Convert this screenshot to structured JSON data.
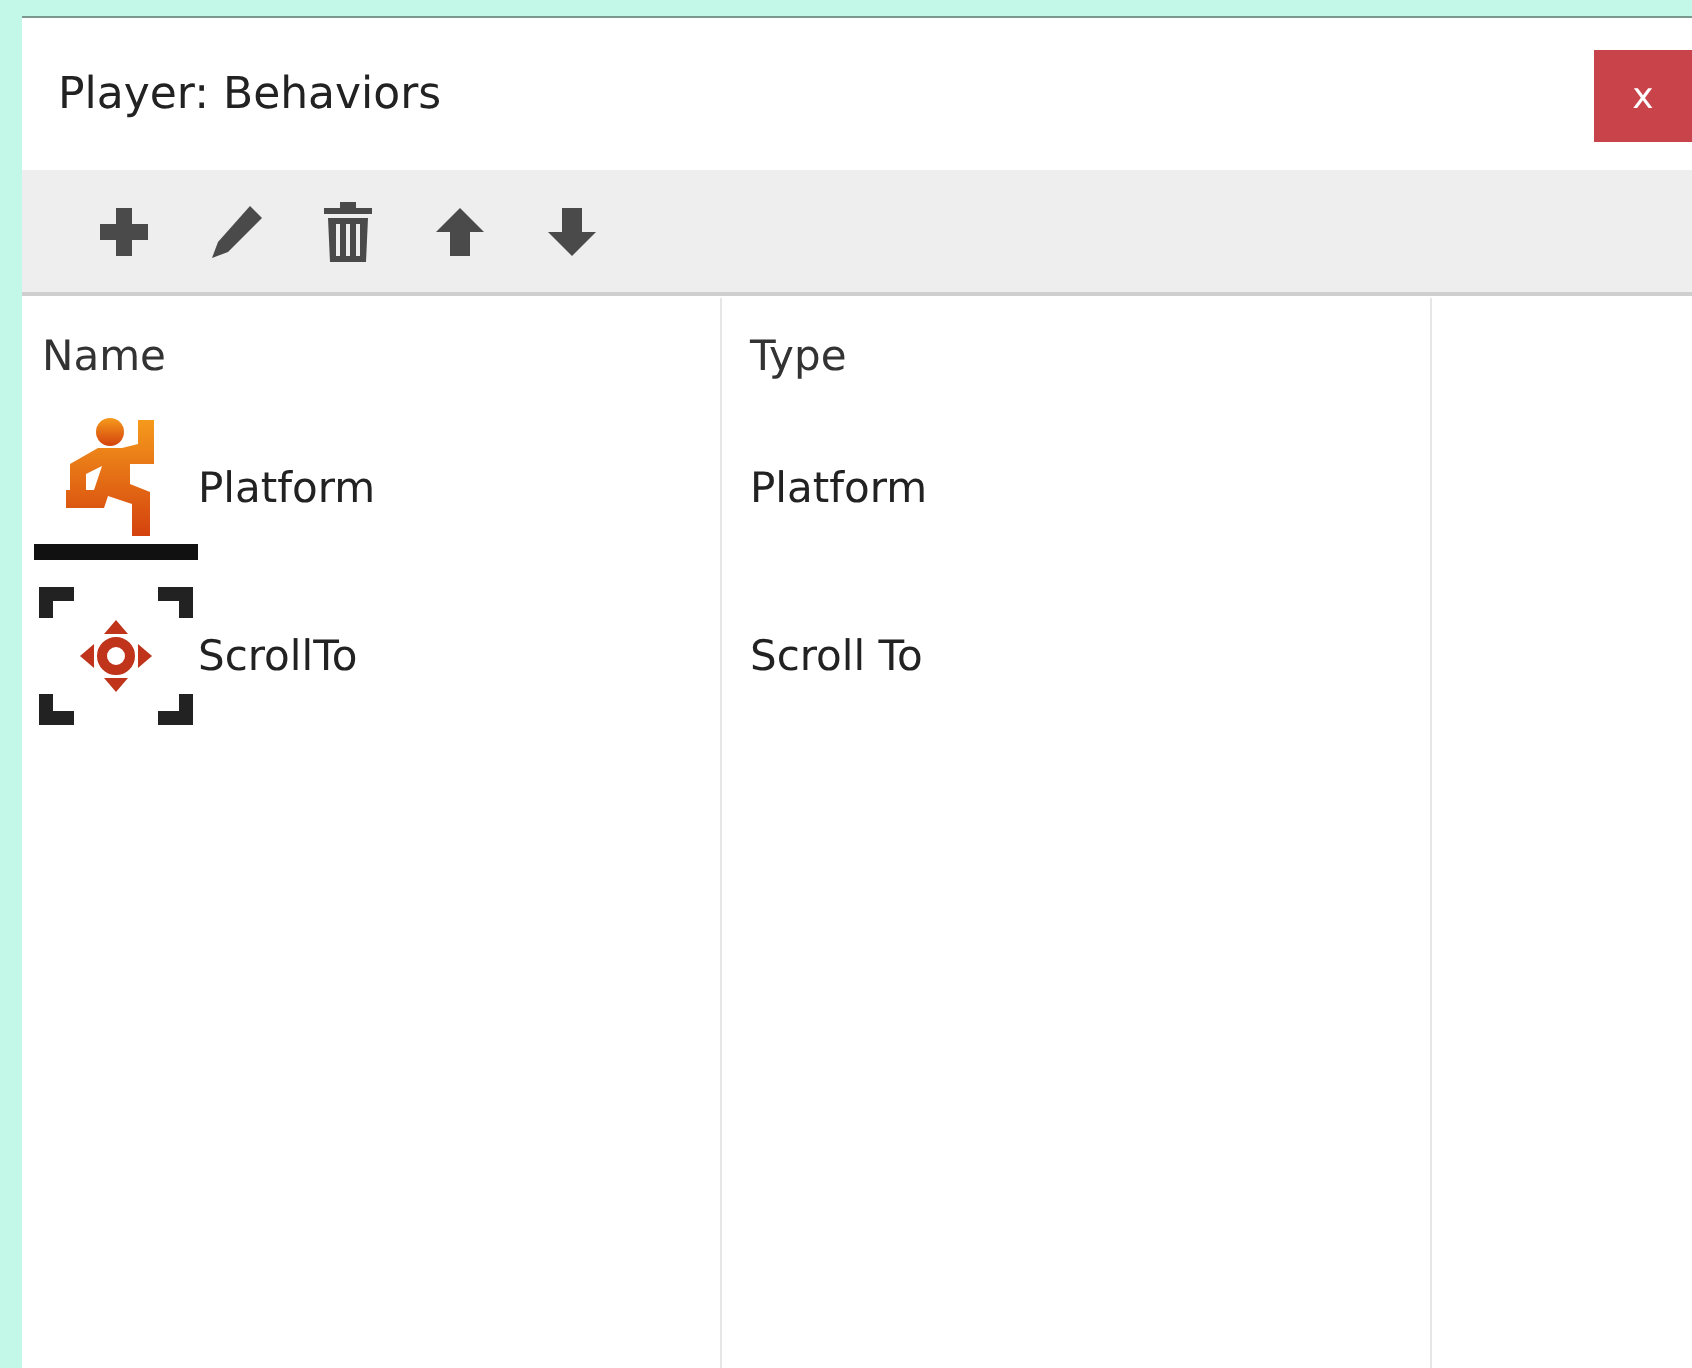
{
  "window": {
    "title": "Player: Behaviors",
    "close": "x"
  },
  "table": {
    "columns": [
      "Name",
      "Type"
    ],
    "rows": [
      {
        "name": "Platform",
        "type": "Platform"
      },
      {
        "name": "ScrollTo",
        "type": "Scroll To"
      }
    ]
  }
}
